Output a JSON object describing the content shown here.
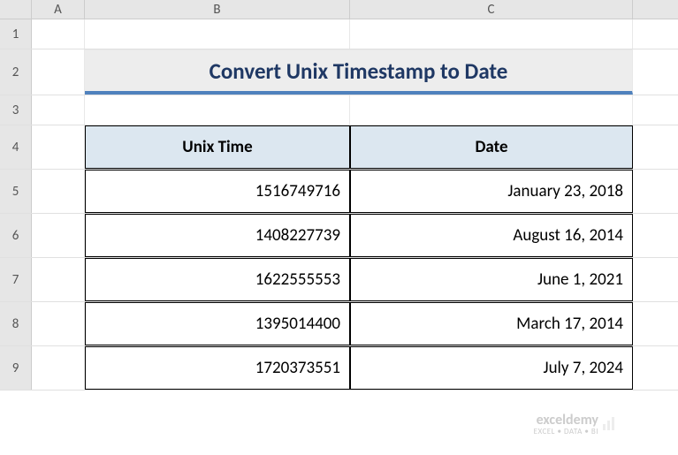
{
  "columns": {
    "A": "A",
    "B": "B",
    "C": "C"
  },
  "rowNums": {
    "r1": "1",
    "r2": "2",
    "r3": "3",
    "r4": "4",
    "r5": "5",
    "r6": "6",
    "r7": "7",
    "r8": "8",
    "r9": "9"
  },
  "title": "Convert Unix Timestamp to Date",
  "headers": {
    "unix": "Unix Time",
    "date": "Date"
  },
  "data": [
    {
      "unix": "1516749716",
      "date": "January 23, 2018"
    },
    {
      "unix": "1408227739",
      "date": "August 16, 2014"
    },
    {
      "unix": "1622555553",
      "date": "June 1, 2021"
    },
    {
      "unix": "1395014400",
      "date": "March 17, 2014"
    },
    {
      "unix": "1720373551",
      "date": "July 7, 2024"
    }
  ],
  "watermark": {
    "name": "exceldemy",
    "tag": "EXCEL • DATA • BI"
  }
}
